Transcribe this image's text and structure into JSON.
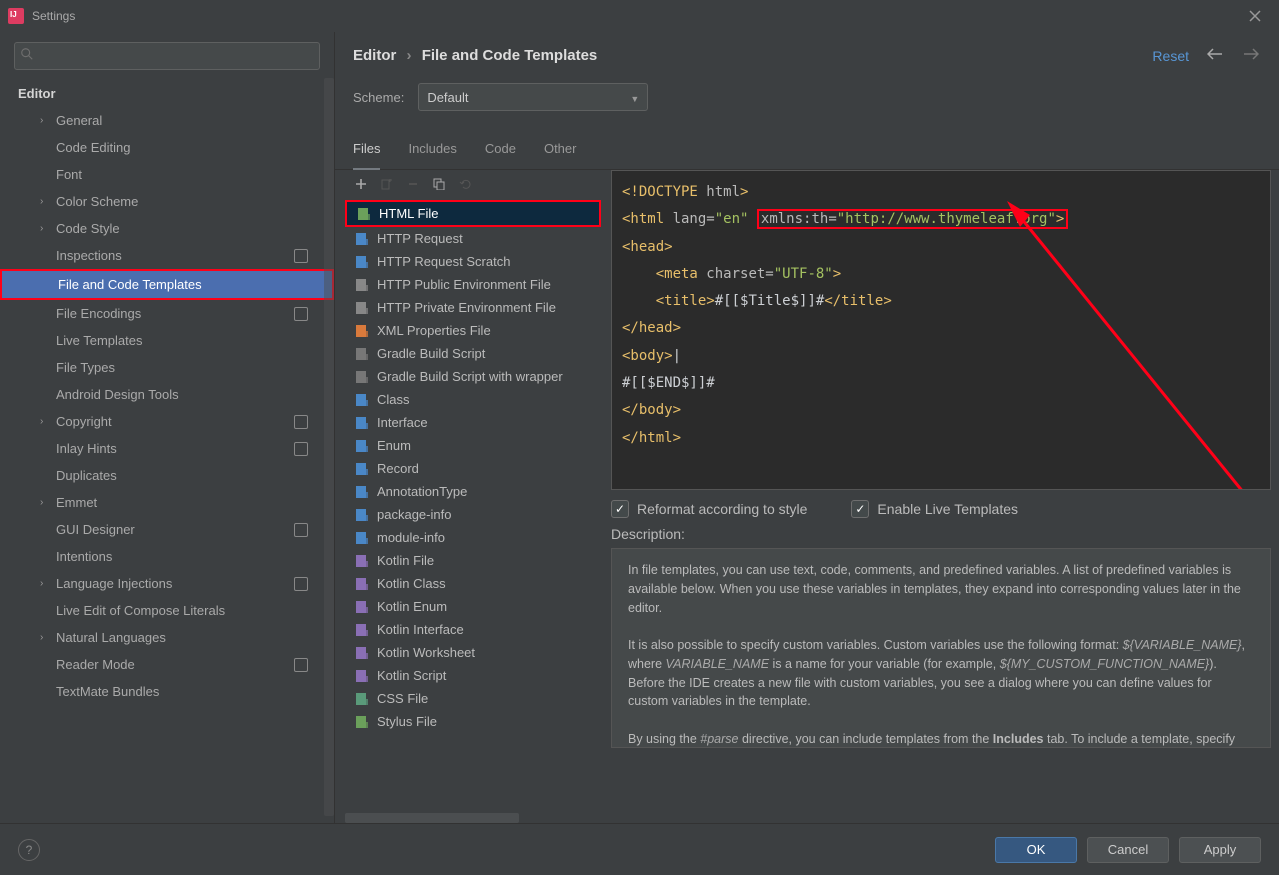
{
  "title": "Settings",
  "sidebar": {
    "header": "Editor",
    "items": [
      {
        "label": "General",
        "expandable": true
      },
      {
        "label": "Code Editing"
      },
      {
        "label": "Font"
      },
      {
        "label": "Color Scheme",
        "expandable": true
      },
      {
        "label": "Code Style",
        "expandable": true
      },
      {
        "label": "Inspections",
        "badge": true
      },
      {
        "label": "File and Code Templates",
        "highlight": true,
        "selected": true
      },
      {
        "label": "File Encodings",
        "badge": true
      },
      {
        "label": "Live Templates"
      },
      {
        "label": "File Types"
      },
      {
        "label": "Android Design Tools"
      },
      {
        "label": "Copyright",
        "expandable": true,
        "badge": true
      },
      {
        "label": "Inlay Hints",
        "badge": true
      },
      {
        "label": "Duplicates"
      },
      {
        "label": "Emmet",
        "expandable": true
      },
      {
        "label": "GUI Designer",
        "badge": true
      },
      {
        "label": "Intentions"
      },
      {
        "label": "Language Injections",
        "expandable": true,
        "badge": true
      },
      {
        "label": "Live Edit of Compose Literals"
      },
      {
        "label": "Natural Languages",
        "expandable": true
      },
      {
        "label": "Reader Mode",
        "badge": true
      },
      {
        "label": "TextMate Bundles"
      }
    ]
  },
  "breadcrumb": {
    "root": "Editor",
    "leaf": "File and Code Templates"
  },
  "header_actions": {
    "reset": "Reset"
  },
  "scheme": {
    "label": "Scheme:",
    "value": "Default"
  },
  "tabs": [
    {
      "label": "Files",
      "active": true
    },
    {
      "label": "Includes"
    },
    {
      "label": "Code"
    },
    {
      "label": "Other"
    }
  ],
  "files": [
    {
      "label": "HTML File",
      "selected": true,
      "highlight": true,
      "color": "#6ba05b"
    },
    {
      "label": "HTTP Request",
      "color": "#4a88c7"
    },
    {
      "label": "HTTP Request Scratch",
      "color": "#4a88c7"
    },
    {
      "label": "HTTP Public Environment File",
      "color": "#888"
    },
    {
      "label": "HTTP Private Environment File",
      "color": "#888"
    },
    {
      "label": "XML Properties File",
      "color": "#d97a3c"
    },
    {
      "label": "Gradle Build Script",
      "color": "#777"
    },
    {
      "label": "Gradle Build Script with wrapper",
      "color": "#777"
    },
    {
      "label": "Class",
      "color": "#4a88c7"
    },
    {
      "label": "Interface",
      "color": "#4a88c7"
    },
    {
      "label": "Enum",
      "color": "#4a88c7"
    },
    {
      "label": "Record",
      "color": "#4a88c7"
    },
    {
      "label": "AnnotationType",
      "color": "#4a88c7"
    },
    {
      "label": "package-info",
      "color": "#4a88c7"
    },
    {
      "label": "module-info",
      "color": "#4a88c7"
    },
    {
      "label": "Kotlin File",
      "color": "#8a6fb5"
    },
    {
      "label": "Kotlin Class",
      "color": "#8a6fb5"
    },
    {
      "label": "Kotlin Enum",
      "color": "#8a6fb5"
    },
    {
      "label": "Kotlin Interface",
      "color": "#8a6fb5"
    },
    {
      "label": "Kotlin Worksheet",
      "color": "#8a6fb5"
    },
    {
      "label": "Kotlin Script",
      "color": "#8a6fb5"
    },
    {
      "label": "CSS File",
      "color": "#5a9a7a"
    },
    {
      "label": "Stylus File",
      "color": "#6ba05b"
    }
  ],
  "editor": {
    "lines": [
      [
        "tag",
        "<!DOCTYPE ",
        "attr",
        "html",
        "tag",
        ">"
      ],
      [
        "tag",
        "<html ",
        "attr",
        "lang=",
        "str",
        "\"en\"",
        "plain",
        " ",
        "boxstart",
        "",
        "attr",
        "xmlns:th=",
        "str",
        "\"http://www.thymeleaf.org\"",
        "tag",
        ">",
        "boxend",
        ""
      ],
      [
        "tag",
        "<head>"
      ],
      [
        "plain",
        "    ",
        "tag",
        "<meta ",
        "attr",
        "charset=",
        "str",
        "\"UTF-8\"",
        "tag",
        ">"
      ],
      [
        "plain",
        "    ",
        "tag",
        "<title>",
        "text",
        "#[[$Title$]]#",
        "tag",
        "</title>"
      ],
      [
        "tag",
        "</head>"
      ],
      [
        "tag",
        "<body>",
        "cursor",
        "|"
      ],
      [
        "text",
        "#[[$END$]]#"
      ],
      [
        "tag",
        "</body>"
      ],
      [
        "tag",
        "</html>"
      ]
    ]
  },
  "options": {
    "reformat": "Reformat according to style",
    "live_templates": "Enable Live Templates"
  },
  "description_label": "Description:",
  "description": {
    "p1a": "In file templates, you can use text, code, comments, and predefined variables. A list of predefined variables is available below. When you use these variables in templates, they expand into corresponding values later in the editor.",
    "p2a": "It is also possible to specify custom variables. Custom variables use the following format: ",
    "p2var1": "${VARIABLE_NAME}",
    "p2b": ", where ",
    "p2var2": "VARIABLE_NAME",
    "p2c": " is a name for your variable (for example, ",
    "p2var3": "${MY_CUSTOM_FUNCTION_NAME}",
    "p2d": "). Before the IDE creates a new file with custom variables, you see a dialog where you can define values for custom variables in the template.",
    "p3a": "By using the ",
    "p3var": "#parse",
    "p3b": " directive, you can include templates from the ",
    "p3bold": "Includes",
    "p3c": " tab. To include a template, specify the full name of the template as a parameter in quotation marks (for"
  },
  "buttons": {
    "ok": "OK",
    "cancel": "Cancel",
    "apply": "Apply"
  }
}
